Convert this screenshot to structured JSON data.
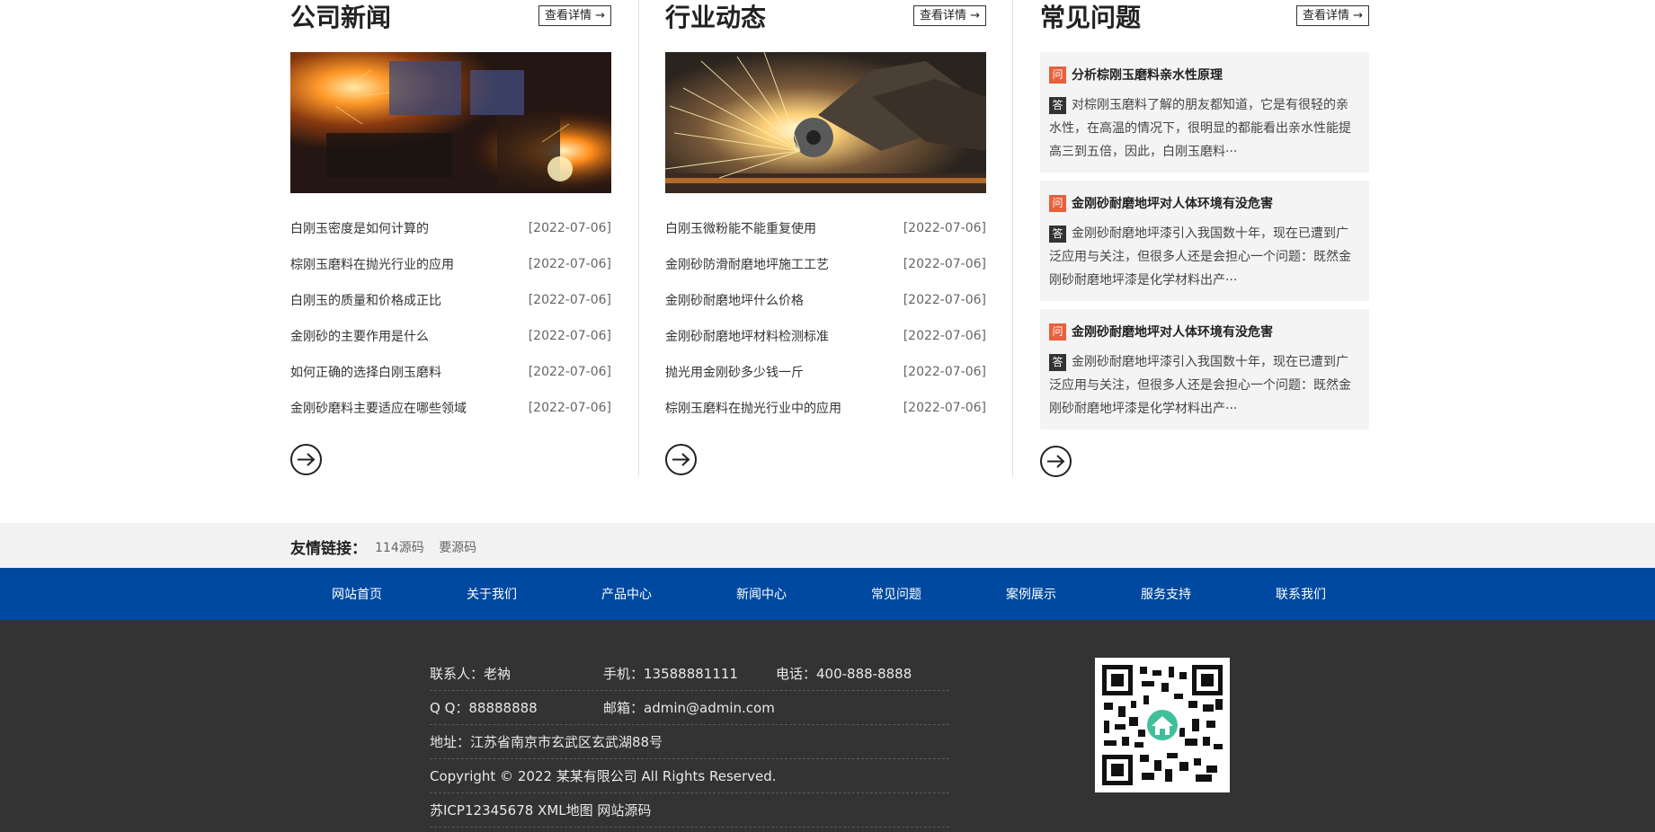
{
  "news": {
    "title": "公司新闻",
    "more_label": "查看详情 →",
    "items": [
      {
        "title": "白刚玉密度是如何计算的",
        "date": "[2022-07-06]"
      },
      {
        "title": "棕刚玉磨料在抛光行业的应用",
        "date": "[2022-07-06]"
      },
      {
        "title": "白刚玉的质量和价格成正比",
        "date": "[2022-07-06]"
      },
      {
        "title": "金刚砂的主要作用是什么",
        "date": "[2022-07-06]"
      },
      {
        "title": "如何正确的选择白刚玉磨料",
        "date": "[2022-07-06]"
      },
      {
        "title": "金刚砂磨料主要适应在哪些领域",
        "date": "[2022-07-06]"
      }
    ]
  },
  "industry": {
    "title": "行业动态",
    "more_label": "查看详情 →",
    "items": [
      {
        "title": "白刚玉微粉能不能重复使用",
        "date": "[2022-07-06]"
      },
      {
        "title": "金刚砂防滑耐磨地坪施工工艺",
        "date": "[2022-07-06]"
      },
      {
        "title": "金刚砂耐磨地坪什么价格",
        "date": "[2022-07-06]"
      },
      {
        "title": "金刚砂耐磨地坪材料检测标准",
        "date": "[2022-07-06]"
      },
      {
        "title": "抛光用金刚砂多少钱一斤",
        "date": "[2022-07-06]"
      },
      {
        "title": "棕刚玉磨料在抛光行业中的应用",
        "date": "[2022-07-06]"
      }
    ]
  },
  "faq": {
    "title": "常见问题",
    "more_label": "查看详情 →",
    "q_badge": "问",
    "a_badge": "答",
    "items": [
      {
        "q": "分析棕刚玉磨料亲水性原理",
        "a": "对棕刚玉磨料了解的朋友都知道，它是有很轻的亲水性，在高温的情况下，很明显的都能看出亲水性能提高三到五倍，因此，白刚玉磨料···"
      },
      {
        "q": "金刚砂耐磨地坪对人体环境有没危害",
        "a": "金刚砂耐磨地坪漆引入我国数十年，现在已遭到广泛应用与关注，但很多人还是会担心一个问题：既然金刚砂耐磨地坪漆是化学材料出产···"
      },
      {
        "q": "金刚砂耐磨地坪对人体环境有没危害",
        "a": "金刚砂耐磨地坪漆引入我国数十年，现在已遭到广泛应用与关注，但很多人还是会担心一个问题：既然金刚砂耐磨地坪漆是化学材料出产···"
      }
    ]
  },
  "links": {
    "label": "友情链接：",
    "items": [
      "114源码",
      "要源码"
    ]
  },
  "nav": {
    "items": [
      "网站首页",
      "关于我们",
      "产品中心",
      "新闻中心",
      "常见问题",
      "案例展示",
      "服务支持",
      "联系我们"
    ]
  },
  "footer": {
    "contact": "联系人：老衲",
    "mobile": "手机：13588881111",
    "phone": "电话：400-888-8888",
    "qq": "Q Q：88888888",
    "email": "邮箱：admin@admin.com",
    "address": "地址：江苏省南京市玄武区玄武湖88号",
    "copyright": "Copyright © 2022 某某有限公司 All Rights Reserved.",
    "icp": "苏ICP12345678 XML地图 网站源码"
  },
  "colors": {
    "nav_bg": "#0049a0",
    "footer_bg": "#333333",
    "q_badge": "#e8603c",
    "a_badge": "#333333"
  },
  "icons": {
    "arrow": "arrow-right-circle-icon",
    "qr": "qr-code-icon"
  }
}
